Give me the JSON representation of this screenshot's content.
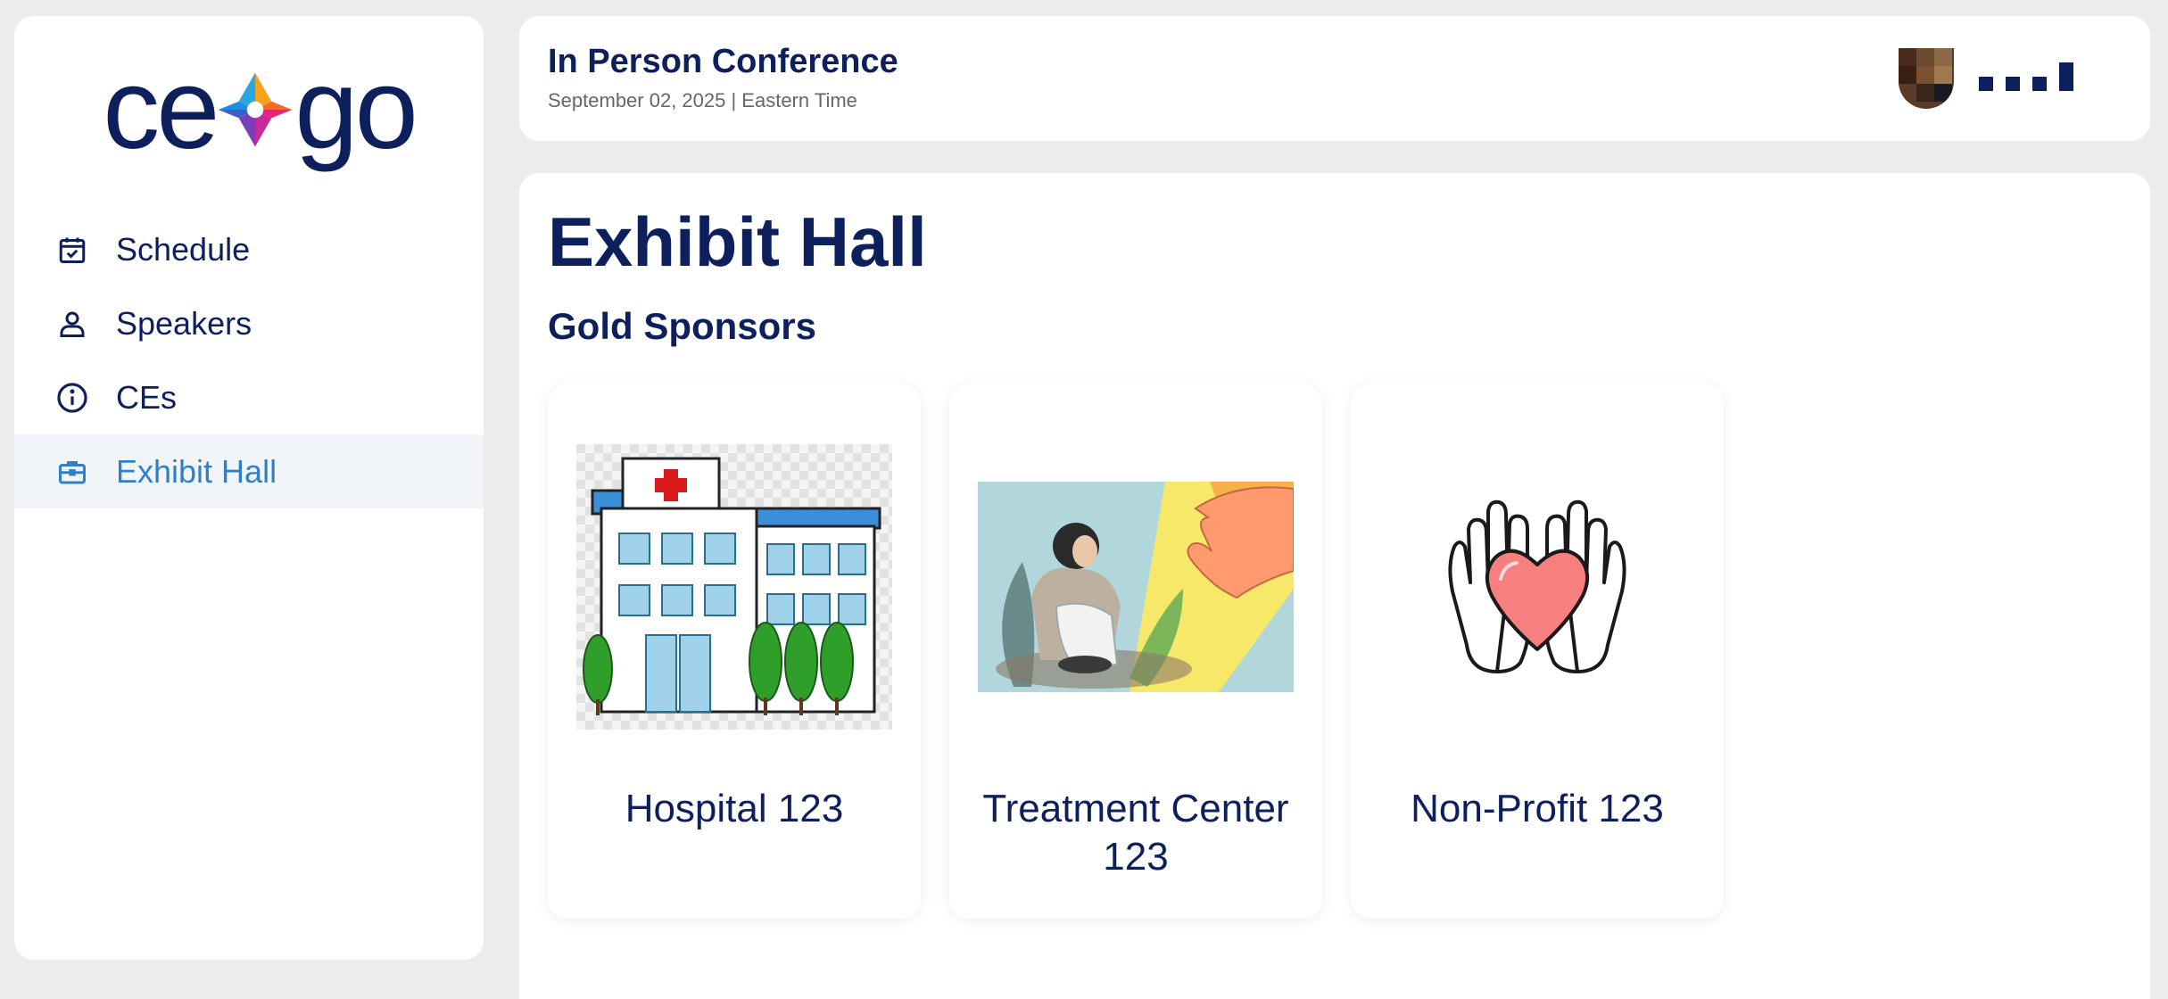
{
  "app": {
    "logo_text_left": "ce",
    "logo_text_right": "go"
  },
  "sidebar": {
    "items": [
      {
        "label": "Schedule",
        "icon": "calendar-check-icon",
        "active": false
      },
      {
        "label": "Speakers",
        "icon": "person-icon",
        "active": false
      },
      {
        "label": "CEs",
        "icon": "info-icon",
        "active": false
      },
      {
        "label": "Exhibit Hall",
        "icon": "briefcase-icon",
        "active": true
      }
    ]
  },
  "header": {
    "title": "In Person Conference",
    "date": "September 02, 2025 | Eastern Time",
    "avatar_icon": "user-avatar",
    "menu_icon": "menu-dots-icon"
  },
  "main": {
    "page_title": "Exhibit Hall",
    "section_title": "Gold Sponsors",
    "sponsors": [
      {
        "name": "Hospital 123",
        "image": "hospital-building-image"
      },
      {
        "name": "Treatment Center 123",
        "image": "helping-hand-illustration"
      },
      {
        "name": "Non-Profit 123",
        "image": "hands-heart-icon"
      }
    ]
  },
  "colors": {
    "primary": "#0d1f5c",
    "active": "#2f80c8",
    "active_bg": "#f1f4f8",
    "background": "#ececec"
  }
}
